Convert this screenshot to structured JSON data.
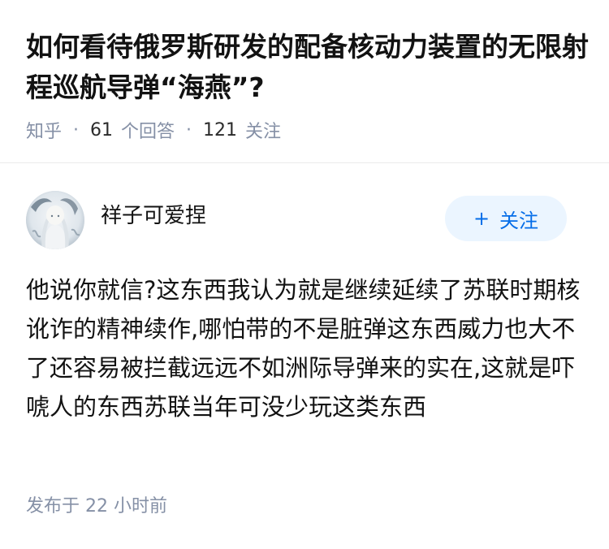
{
  "question": {
    "title": "如何看待俄罗斯研发的配备核动力装置的无限射程巡航导弹“海燕”?",
    "site": "知乎",
    "answer_count": "61",
    "answer_label": "个回答",
    "follower_count": "121",
    "follower_label": "关注"
  },
  "answer": {
    "author_name": "祥子可爱捏",
    "follow_plus": "+",
    "follow_label": "关注",
    "content": "他说你就信?这东西我认为就是继续延续了苏联时期核讹诈的精神续作,哪怕带的不是脏弹这东西威力也大不了还容易被拦截远远不如洲际导弹来的实在,这就是吓唬人的东西苏联当年可没少玩这类东西",
    "posted_prefix": "发布于",
    "posted_time": "22 小时前"
  },
  "colors": {
    "text": "#121212",
    "meta": "#8590a6",
    "accent": "#056de8",
    "follow_bg": "#ebf5ff",
    "divider": "#ebebeb"
  },
  "icons": {
    "avatar": "user-avatar-illustration"
  }
}
